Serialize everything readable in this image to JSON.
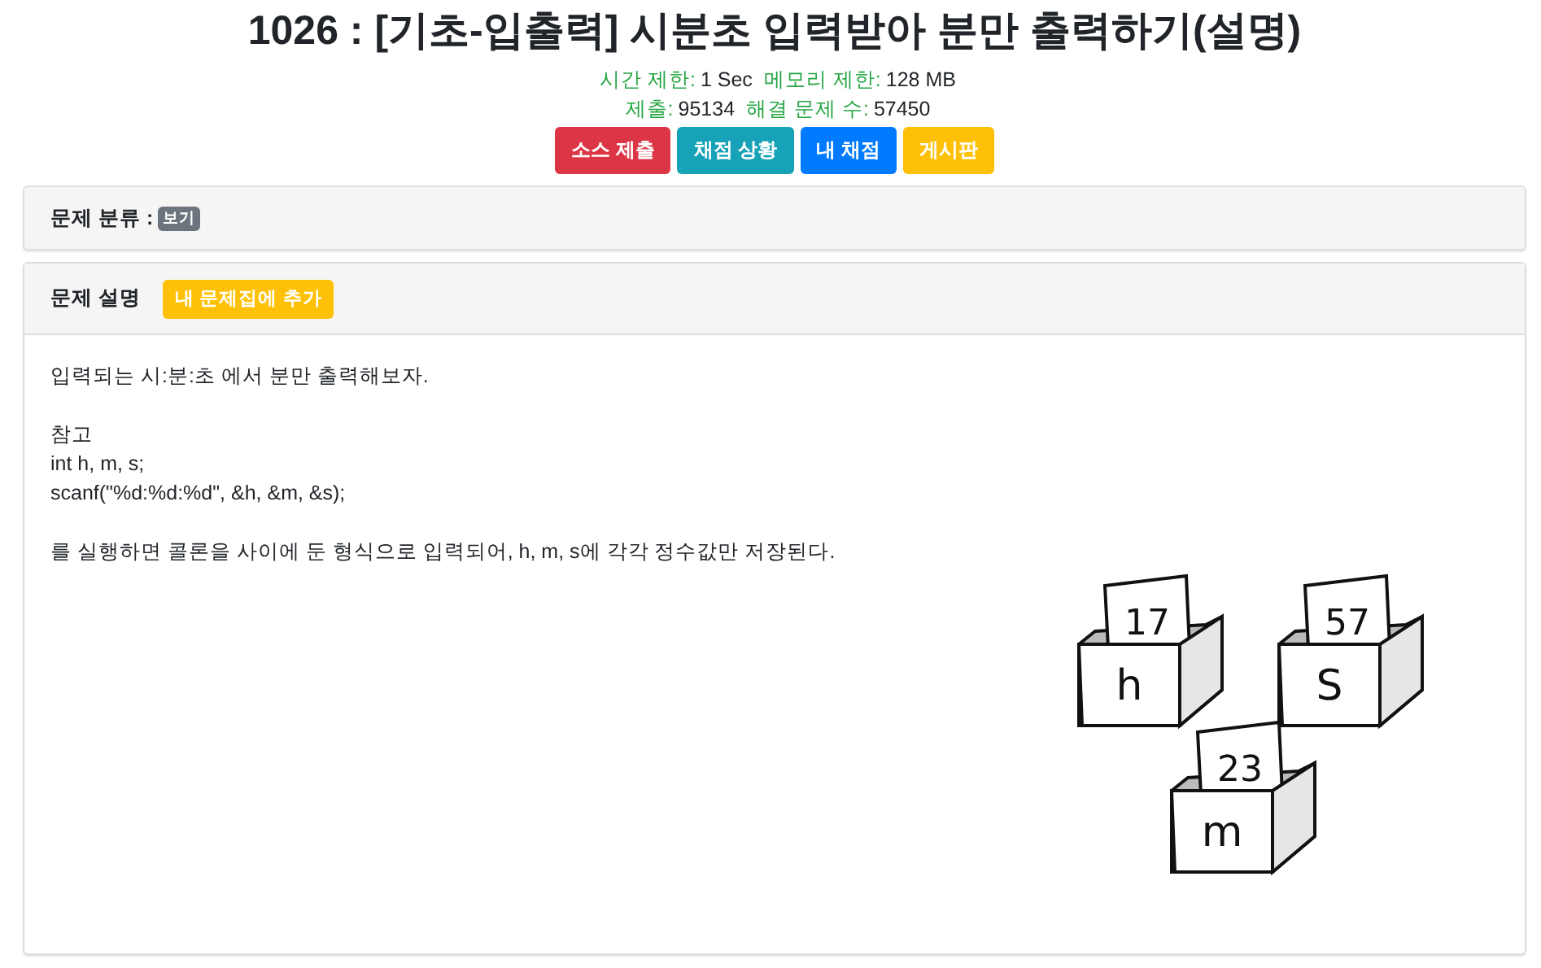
{
  "title": "1026 : [기초-입출력] 시분초 입력받아 분만 출력하기(설명)",
  "info_lines": [
    [
      {
        "label": "시간 제한:",
        "value": "1 Sec"
      },
      {
        "label": "메모리 제한:",
        "value": "128 MB"
      }
    ],
    [
      {
        "label": "제출:",
        "value": "95134"
      },
      {
        "label": "해결 문제 수:",
        "value": "57450"
      }
    ]
  ],
  "buttons": [
    {
      "label": "소스 제출",
      "kind": "danger"
    },
    {
      "label": "채점 상황",
      "kind": "info"
    },
    {
      "label": "내 채점",
      "kind": "primary"
    },
    {
      "label": "게시판",
      "kind": "warning"
    }
  ],
  "category_panel": {
    "heading": "문제 분류 :",
    "badge": "보기"
  },
  "description_panel": {
    "heading": "문제 설명",
    "add_button": "내 문제집에 추가",
    "paragraphs": [
      [
        "입력되는 시:분:초 에서 분만 출력해보자."
      ],
      [
        "참고",
        "int h, m, s;",
        "scanf(\"%d:%d:%d\", &h, &m, &s);"
      ],
      [
        "를 실행하면 콜론을 사이에 둔 형식으로 입력되어, h, m, s에 각각 정수값만 저장된다."
      ]
    ],
    "illustration": [
      {
        "card": "17",
        "label": "h"
      },
      {
        "card": "57",
        "label": "S"
      },
      {
        "card": "23",
        "label": "m"
      }
    ]
  }
}
